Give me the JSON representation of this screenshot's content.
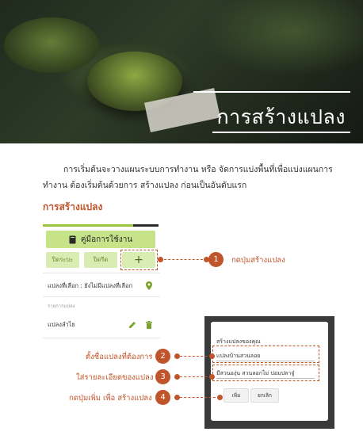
{
  "hero": {
    "title": "การสร้างแปลง"
  },
  "intro": {
    "line1": "การเริ่มต้นจะวางแผนระบบการทำงาน หรือ จัดการแบ่งพื้นที่เพื่อแบ่งแผนการ",
    "line2": "ทำงาน ต้องเริ่มต้นด้วยการ สร้างแปลง ก่อนเป็นอันดับแรก"
  },
  "section": {
    "title": "การสร้างแปลง"
  },
  "app": {
    "manual_button": "คู่มือการใช้งาน",
    "button_left": "ปิดระบะ",
    "button_middle": "ปิดรีด",
    "button_add": "+",
    "selected_plot": "แปลงที่เลือก : ยังไม่มีแปลงที่เลือก",
    "plot_list_heading": "รายการแปลง",
    "plot_item": "แปลงลำไย"
  },
  "dialog": {
    "title": "สร้างแปลงของคุณ",
    "name_value": "แปลงบ้านสวนลอย",
    "detail_value": "มีสวนองุ่น สวนลอกไม่ ปอมปลาจู๋",
    "confirm_button": "เพิ่ม",
    "cancel_button": "ยกเลิก"
  },
  "callouts": [
    {
      "number": "1",
      "text": "กดปุ่มสร้างแปลง"
    },
    {
      "number": "2",
      "text": "ตั้งชื่อแปลงที่ต้องการ"
    },
    {
      "number": "3",
      "text": "ใส่รายละเอียดของแปลง"
    },
    {
      "number": "4",
      "text": "กดปุ่มเพิ่ม เพื่อ สร้างแปลง"
    }
  ],
  "colors": {
    "accent": "#c0542a",
    "app_green": "#9bc53d",
    "light_green": "#c6e38a"
  }
}
